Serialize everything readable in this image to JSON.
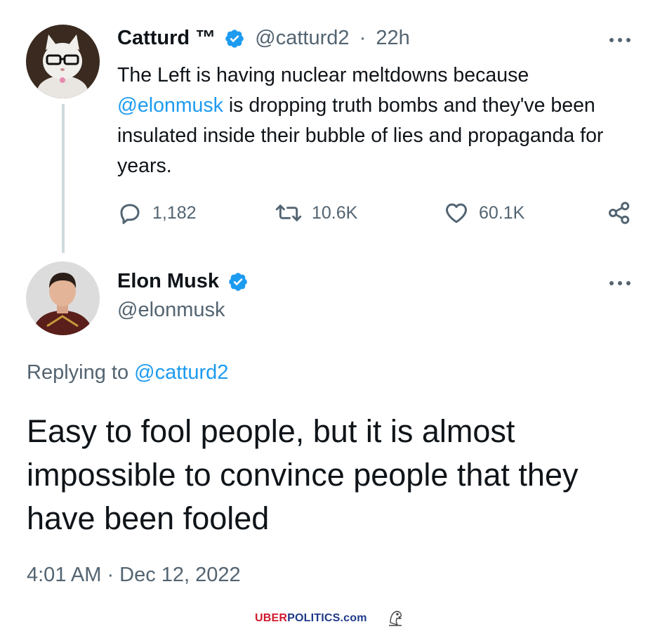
{
  "parent_tweet": {
    "author": {
      "name": "Catturd ™",
      "handle": "@catturd2",
      "verified": true
    },
    "separator": "·",
    "time_ago": "22h",
    "text_before_mention": "The Left is having nuclear meltdowns because",
    "mention": "@elonmusk",
    "text_after_mention": "is dropping truth bombs and they've been insulated inside their bubble of lies and propaganda for years.",
    "stats": {
      "replies": "1,182",
      "retweets": "10.6K",
      "likes": "60.1K"
    }
  },
  "reply_tweet": {
    "author": {
      "name": "Elon Musk",
      "handle": "@elonmusk",
      "verified": true
    },
    "replying_to_label": "Replying to",
    "replying_to_handle": "@catturd2",
    "text": "Easy to fool people, but it is almost impossible to convince people that they have been fooled",
    "timestamp": "4:01 AM · Dec 12, 2022"
  },
  "watermark": {
    "part1": "UBER",
    "part2": "POLITICS.com"
  },
  "colors": {
    "accent": "#1d9bf0",
    "secondary_text": "#536471",
    "primary_text": "#0f1419",
    "watermark_red": "#d0192c",
    "watermark_blue": "#1f3a8a"
  },
  "icons": [
    "reply-icon",
    "retweet-icon",
    "like-icon",
    "share-icon",
    "verified-badge-icon",
    "more-icon"
  ]
}
